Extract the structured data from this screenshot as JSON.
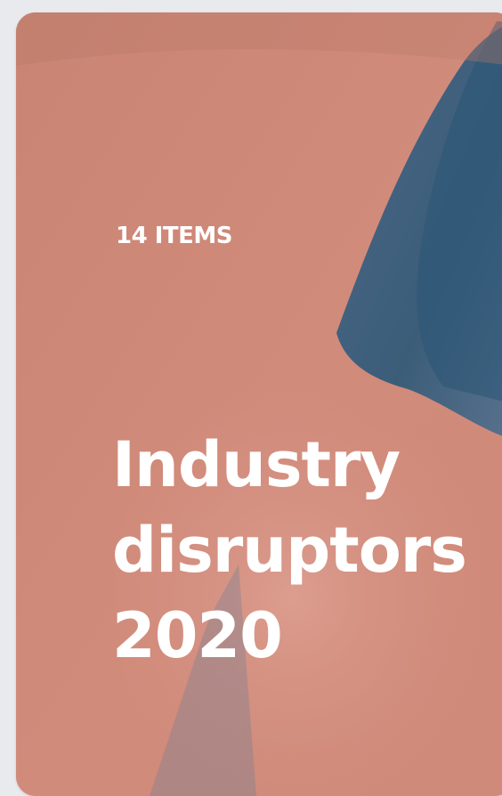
{
  "card": {
    "item_count_label": "14 ITEMS",
    "title_lines": [
      "Industry",
      "disruptors",
      "2020"
    ],
    "image_icon": "portrait-photo",
    "colors": {
      "background": "#e9eaee",
      "card_tint": "#d08a7a",
      "photo_shadow": "#2e5a7e",
      "text": "#ffffff"
    }
  }
}
